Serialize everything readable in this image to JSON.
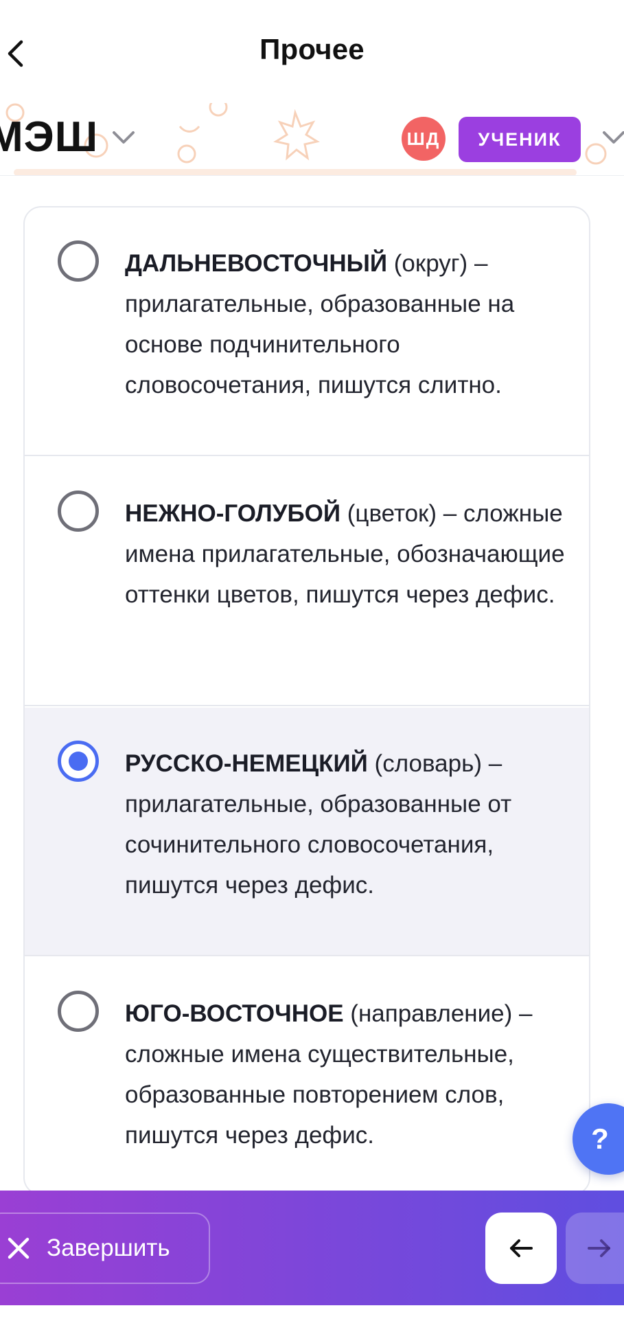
{
  "header": {
    "title": "Прочее",
    "brand": "МЭШ",
    "avatar_initials": "ШД",
    "role_badge": "УЧЕНИК"
  },
  "options": [
    {
      "term": "ДАЛЬНЕВОСТОЧНЫЙ",
      "hint": "(округ)",
      "explanation": "– прилагательные, образованные на основе подчинительного словосочетания, пишутся слитно.",
      "selected": false
    },
    {
      "term": "НЕЖНО-ГОЛУБОЙ",
      "hint": "(цветок)",
      "explanation": "– сложные имена прилагательные, обозначающие оттенки цветов, пишутся через дефис.",
      "selected": false
    },
    {
      "term": "РУССКО-НЕМЕЦКИЙ",
      "hint": "(словарь)",
      "explanation": "– прилагательные, образованные от сочинительного словосочетания, пишутся через дефис.",
      "selected": true
    },
    {
      "term": "ЮГО-ВОСТОЧНОЕ",
      "hint": "(направление)",
      "explanation": "– сложные имена существительные, образованные повторением слов, пишутся через дефис.",
      "selected": false
    }
  ],
  "help": {
    "label": "?"
  },
  "footer": {
    "finish_label": "Завершить"
  },
  "colors": {
    "accent": "#4a6cf2",
    "role_badge": "#9b3fe0",
    "avatar": "#f26464",
    "footer_start": "#9a3fd4",
    "footer_end": "#5f4ee0"
  },
  "icons": {
    "back": "chevron-left-icon",
    "brand_dropdown": "chevron-down-icon",
    "role_dropdown": "chevron-down-icon",
    "finish": "close-icon",
    "prev": "arrow-left-icon",
    "next": "arrow-right-icon"
  }
}
